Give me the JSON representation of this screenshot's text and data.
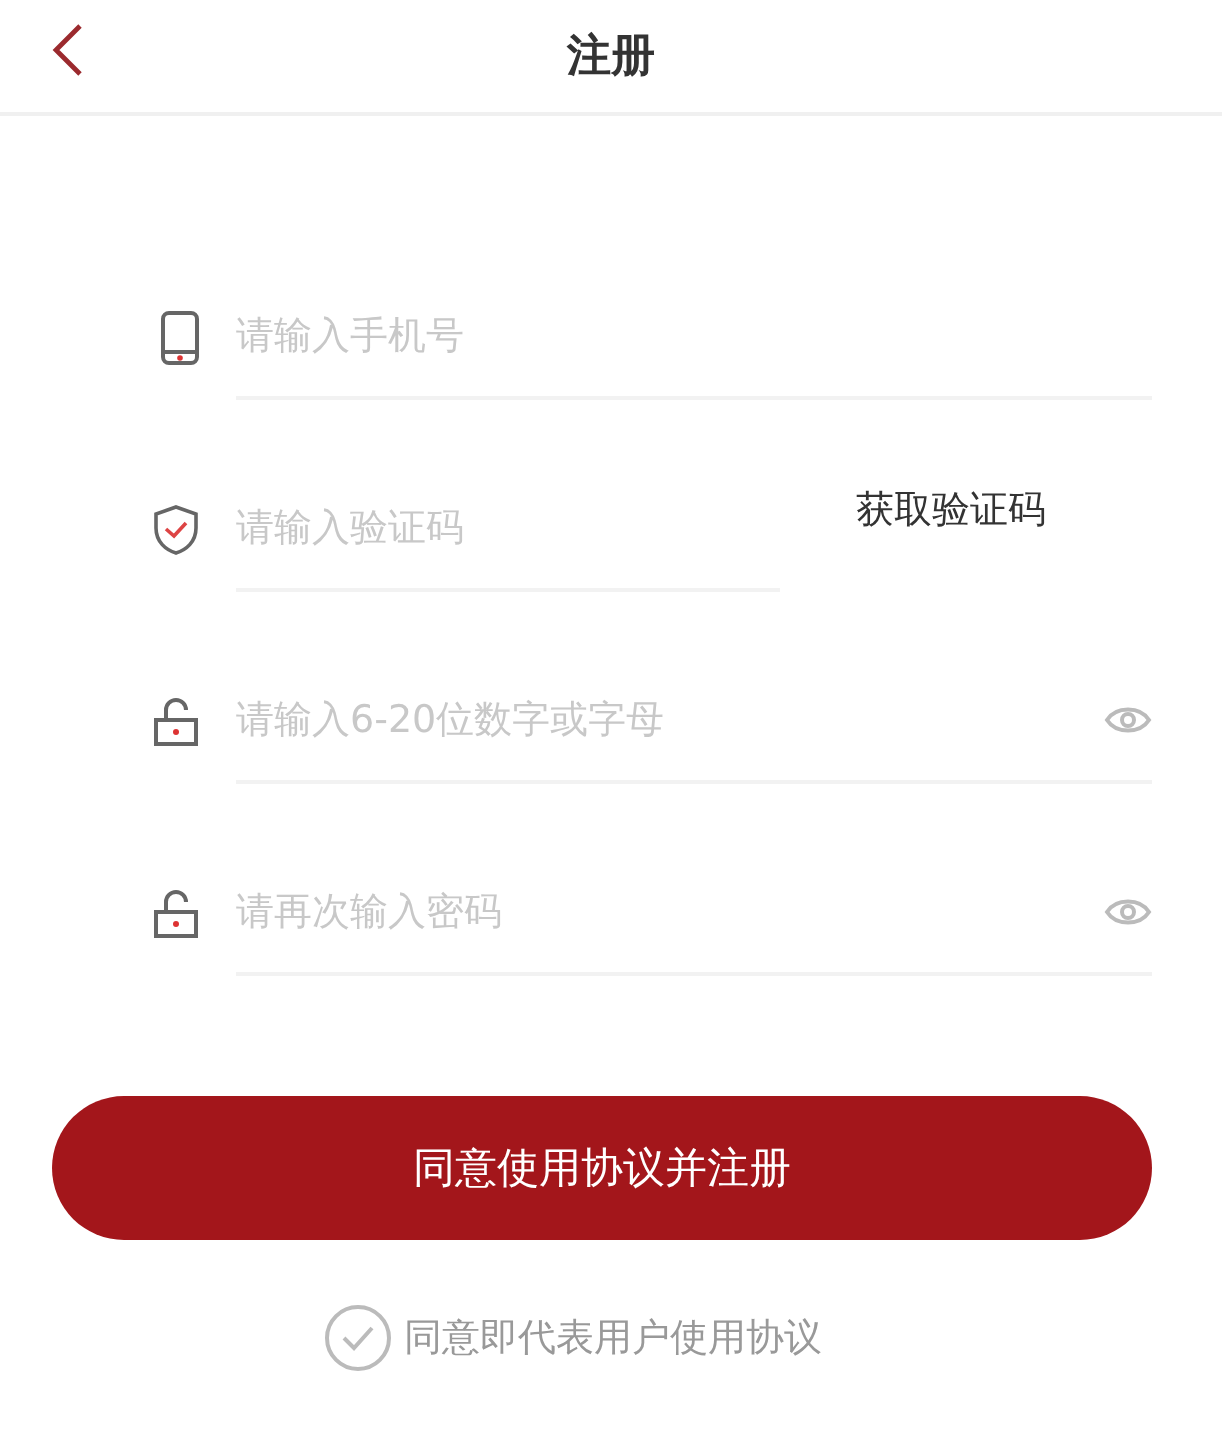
{
  "header": {
    "title": "注册"
  },
  "fields": [
    {
      "kind": "phone",
      "placeholder": "请输入手机号"
    },
    {
      "kind": "code",
      "placeholder": "请输入验证码",
      "action": "获取验证码"
    },
    {
      "kind": "password",
      "placeholder": "请输入6-20位数字或字母"
    },
    {
      "kind": "password",
      "placeholder": "请再次输入密码"
    }
  ],
  "submit": {
    "label": "同意使用协议并注册"
  },
  "agreement": {
    "label": "同意即代表用户使用协议",
    "checked": false
  }
}
